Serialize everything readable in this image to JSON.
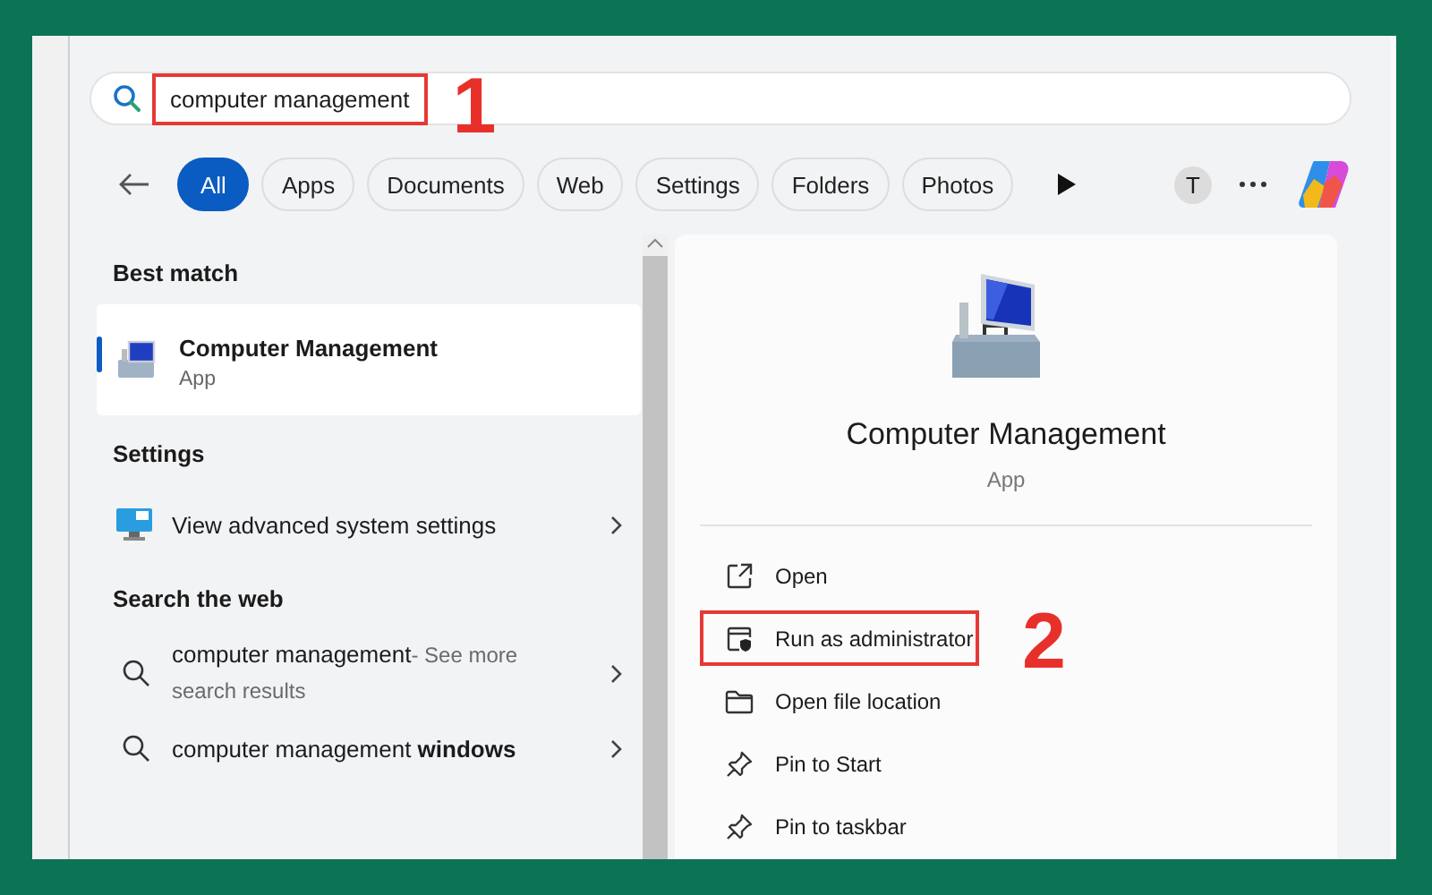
{
  "search": {
    "value": "computer management",
    "annotated": true,
    "annotation": "1"
  },
  "filters": [
    {
      "label": "All",
      "selected": true
    },
    {
      "label": "Apps",
      "selected": false
    },
    {
      "label": "Documents",
      "selected": false
    },
    {
      "label": "Web",
      "selected": false
    },
    {
      "label": "Settings",
      "selected": false
    },
    {
      "label": "Folders",
      "selected": false
    },
    {
      "label": "Photos",
      "selected": false
    }
  ],
  "account": {
    "initial": "T"
  },
  "sections": [
    {
      "title": "Best match",
      "items": [
        {
          "kind": "app",
          "title": "Computer Management",
          "subtitle": "App",
          "selected": true
        }
      ]
    },
    {
      "title": "Settings",
      "items": [
        {
          "kind": "setting",
          "title": "View advanced system settings",
          "selected": false
        }
      ]
    },
    {
      "title": "Search the web",
      "items": [
        {
          "kind": "web",
          "title": "computer management",
          "suffix": "- See more search results",
          "selected": false
        },
        {
          "kind": "web",
          "title": "computer management **windows**",
          "selected": false
        }
      ]
    }
  ],
  "details": {
    "title": "Computer Management",
    "subtitle": "App",
    "actions": [
      {
        "kind": "open",
        "label": "Open",
        "annotated": false
      },
      {
        "kind": "admin",
        "label": "Run as administrator",
        "annotated": true,
        "annotation": "2"
      },
      {
        "kind": "folder",
        "label": "Open file location",
        "annotated": false
      },
      {
        "kind": "pin",
        "label": "Pin to Start",
        "annotated": false
      },
      {
        "kind": "pin",
        "label": "Pin to taskbar",
        "annotated": false
      }
    ]
  }
}
